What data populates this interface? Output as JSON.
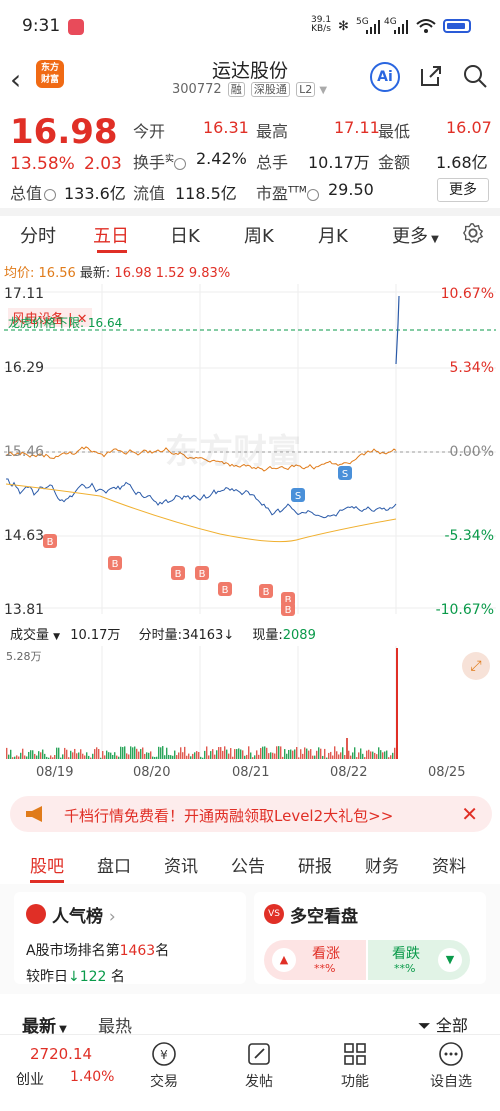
{
  "status_bar": {
    "time": "9:31",
    "net_speed": "39.1",
    "net_unit": "KB/s",
    "bt": "✻",
    "sig1": "5G",
    "sig2": "4G"
  },
  "header": {
    "title": "运达股份",
    "code": "300772",
    "tags": [
      "融",
      "深股通",
      "L2"
    ],
    "logo_line1": "东方",
    "logo_line2": "财富",
    "ai": "Ai"
  },
  "quote": {
    "price": "16.98",
    "change_pct": "13.58%",
    "change": "2.03",
    "open_label": "今开",
    "open": "16.31",
    "high_label": "最高",
    "high": "17.11",
    "low_label": "最低",
    "low": "16.07",
    "turnover_label": "换手",
    "turnover_sup": "实",
    "turnover": "2.42%",
    "volume_label": "总手",
    "volume": "10.17万",
    "amount_label": "金额",
    "amount": "1.68亿",
    "mktcap_label": "总值",
    "mktcap": "133.6亿",
    "float_label": "流值",
    "float": "118.5亿",
    "pe_label": "市盈",
    "pe_sup": "TTM",
    "pe": "29.50",
    "more": "更多"
  },
  "period_tabs": [
    "分时",
    "五日",
    "日K",
    "周K",
    "月K",
    "更多"
  ],
  "active_period": "五日",
  "avg_line": {
    "avg_label": "均价:",
    "avg": "16.56",
    "last_label": "最新:",
    "last": "16.98",
    "chg": "1.52",
    "pct": "9.83%"
  },
  "chart_data": {
    "type": "line",
    "y_left": [
      "17.11",
      "16.29",
      "15.46",
      "14.63",
      "13.81"
    ],
    "y_right": [
      "10.67%",
      "5.34%",
      "0.00%",
      "-5.34%",
      "-10.67%"
    ],
    "annotation_tag": "风电设备",
    "limit_text": "龙虎价格下限: 16.64",
    "watermark": "东方财富",
    "x_dates": [
      "08/19",
      "08/20",
      "08/21",
      "08/22",
      "08/25"
    ],
    "markers": [
      "B",
      "B",
      "B",
      "B",
      "B",
      "B",
      "B",
      "B",
      "S",
      "S"
    ]
  },
  "volume": {
    "label": "成交量",
    "total": "10.17万",
    "tick_label": "分时量:",
    "tick": "34163",
    "tick_arrow": "↓",
    "now_label": "现量:",
    "now": "2089",
    "max": "5.28万"
  },
  "banner": {
    "text": "千档行情免费看！开通两融领取Level2大礼包>>"
  },
  "sub_tabs": [
    "股吧",
    "盘口",
    "资讯",
    "公告",
    "研报",
    "财务",
    "资料"
  ],
  "popularity": {
    "title": "人气榜",
    "rank_prefix": "A股市场排名第",
    "rank": "1463",
    "rank_suffix": "名",
    "delta_prefix": "较昨日",
    "delta": "122",
    "delta_suffix": "名"
  },
  "sentiment": {
    "title": "多空看盘",
    "bull": "看涨",
    "bear": "看跌",
    "bull_val": "**%",
    "bear_val": "**%"
  },
  "feed_tabs": [
    "最新",
    "最热"
  ],
  "filter": "全部",
  "bottom_nav": {
    "index_value": "2720.14",
    "index_name": "创业",
    "index_pct": "1.40%",
    "items": [
      "交易",
      "发帖",
      "功能",
      "设自选"
    ]
  },
  "colors": {
    "up": "#e02f26",
    "down": "#0a9a4a",
    "price_line": "#2a5aa8",
    "avg_line": "#e07b1a",
    "accent": "#f06a14"
  }
}
